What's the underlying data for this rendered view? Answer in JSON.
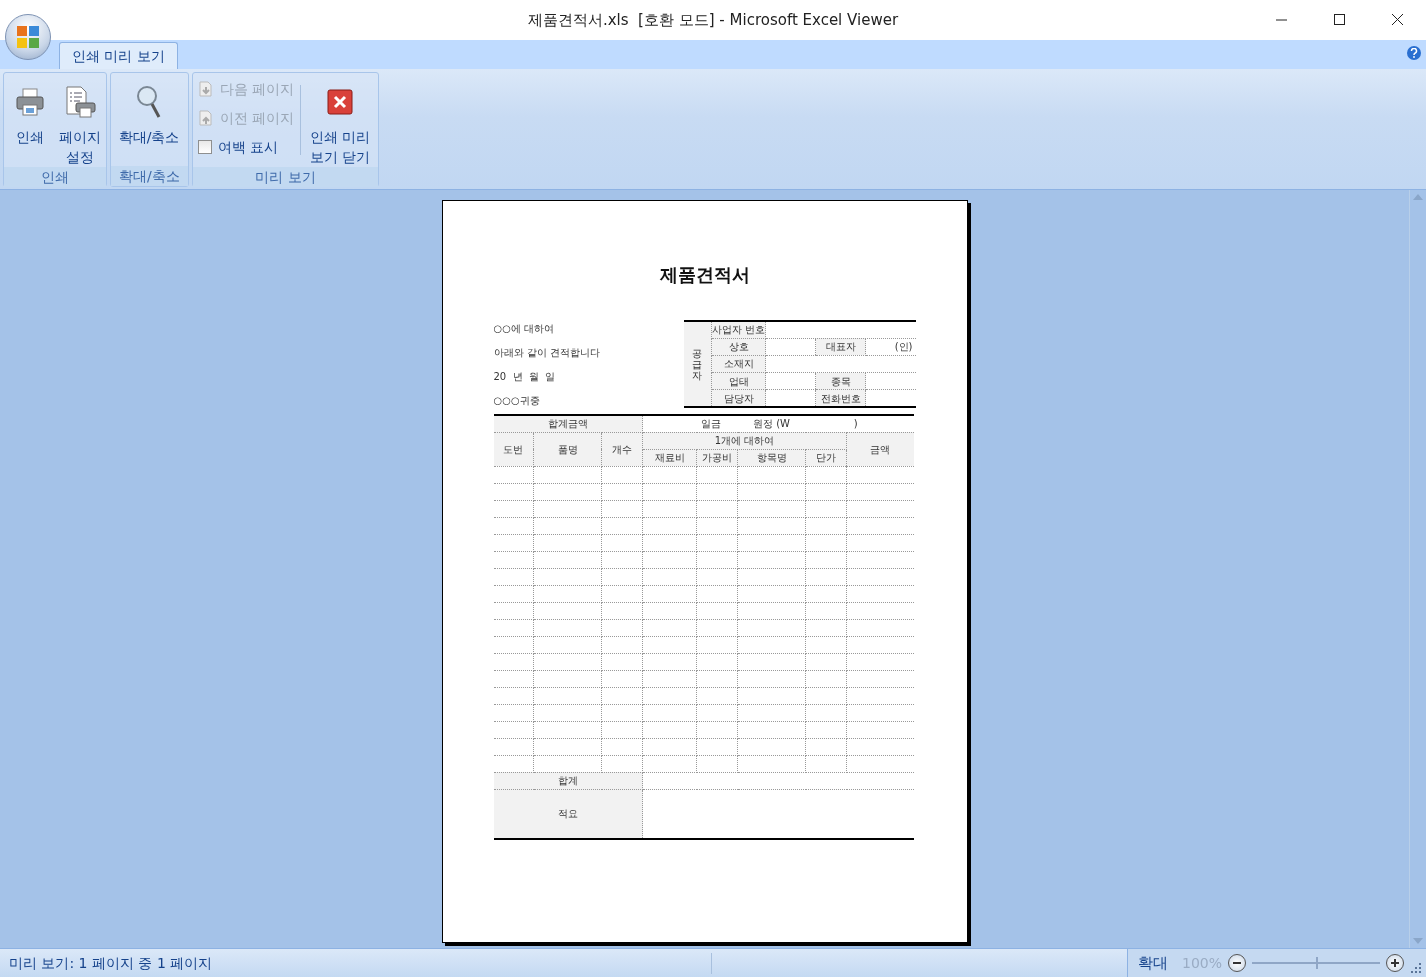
{
  "window": {
    "title": "제품견적서.xls  [호환 모드] - Microsoft Excel Viewer"
  },
  "tabs": [
    {
      "label": "인쇄 미리 보기",
      "selected": true
    }
  ],
  "ribbon": {
    "groups": [
      {
        "label": "인쇄",
        "items": [
          {
            "kind": "print",
            "label": "인쇄",
            "disabled": false
          },
          {
            "kind": "page_setup",
            "label": "페이지 설정",
            "disabled": false
          }
        ]
      },
      {
        "label": "확대/축소",
        "items": [
          {
            "kind": "zoom",
            "label": "확대/축소",
            "disabled": false
          }
        ]
      },
      {
        "label": "미리 보기",
        "items": [
          {
            "kind": "next_page",
            "label": "다음 페이지",
            "disabled": true
          },
          {
            "kind": "prev_page",
            "label": "이전 페이지",
            "disabled": true
          },
          {
            "kind": "checkbox",
            "label": "여백 표시",
            "checked": false,
            "disabled": false
          },
          {
            "kind": "close_preview",
            "label": "인쇄 미리 보기 닫기",
            "disabled": false
          }
        ]
      }
    ]
  },
  "document": {
    "title": "제품견적서",
    "intro": [
      "○○에 대하여",
      "아래와 같이 견적합니다",
      "20  년  월  일",
      "○○○귀중"
    ],
    "supplier": {
      "side_label": "공급자",
      "rows": [
        {
          "label": "사업자 번호"
        },
        {
          "label": "상호",
          "label_2": "대표자",
          "value_2": "(인)"
        },
        {
          "label": "소재지"
        },
        {
          "label": "업태",
          "label_2": "종목"
        },
        {
          "label": "담당자",
          "label_2": "전화번호"
        }
      ]
    },
    "total_amount": {
      "label": "합계금액",
      "parts": [
        "일금",
        "원정 (W",
        ")"
      ]
    },
    "columns": [
      "도번",
      "품명",
      "개수",
      "재료비",
      "가공비",
      "항목명",
      "단가",
      "금액"
    ],
    "column_group": "1개에 대하여",
    "footer": [
      "합계",
      "적요"
    ]
  },
  "status_bar": {
    "text": "미리 보기: 1 페이지 중 1 페이지",
    "zoom_label": "확대",
    "zoom_value": "100%",
    "zoom": {
      "level": 0.5
    }
  }
}
